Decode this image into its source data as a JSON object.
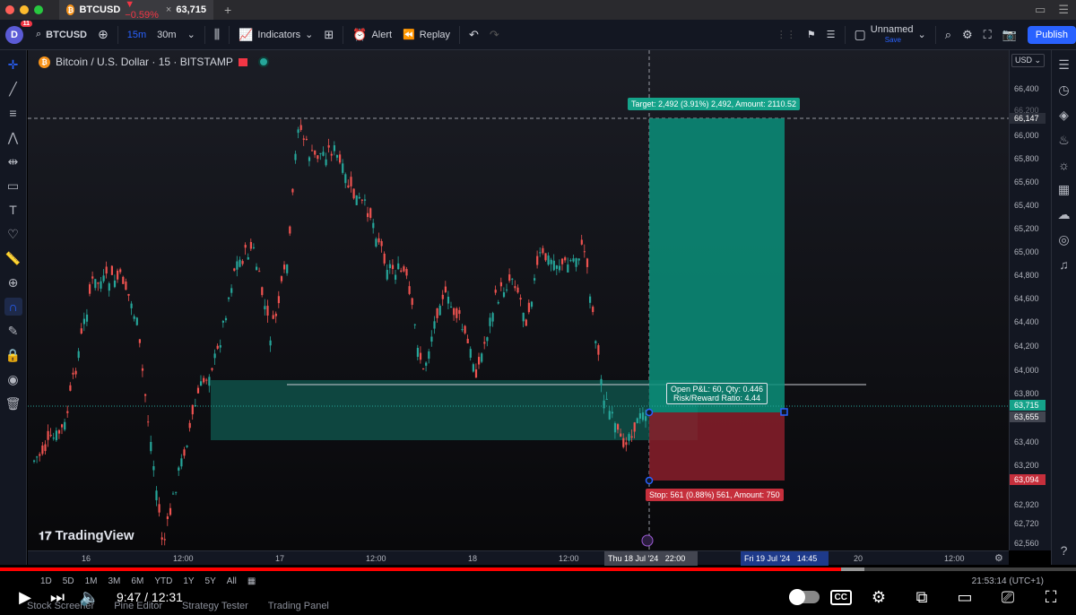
{
  "browser": {
    "tab_symbol": "BTCUSD",
    "tab_price": "63,715",
    "tab_change": "▼ −0.59%",
    "tab_coin": "₿",
    "tab_close": "×",
    "new_tab": "+"
  },
  "toolbar": {
    "avatar": "D",
    "notification_count": "11",
    "symbol": "BTCUSD",
    "interval_active": "15m",
    "interval_fav": "30m",
    "indicators_label": "Indicators",
    "alert_label": "Alert",
    "replay_label": "Replay",
    "layout_name": "Unnamed",
    "layout_status": "Save",
    "publish_label": "Publish"
  },
  "chart": {
    "title": "Bitcoin / U.S. Dollar · 15 · BITSTAMP",
    "logo": "TradingView",
    "target_label": "Target: 2,492 (3.91%) 2,492, Amount: 2110.52",
    "stop_label": "Stop: 561 (0.88%) 561, Amount: 750",
    "pnl_label_1": "Open P&L: 60, Qty: 0.446",
    "pnl_label_2": "Risk/Reward Ratio: 4.44"
  },
  "price_axis": {
    "currency": "USD",
    "ticks": [
      "66,400",
      "66,200",
      "66,000",
      "65,800",
      "65,600",
      "65,400",
      "65,200",
      "65,000",
      "64,800",
      "64,600",
      "64,400",
      "64,200",
      "64,000",
      "63,800",
      "63,400",
      "63,200",
      "62,920",
      "62,720",
      "62,560"
    ],
    "badge_target": "66,147",
    "badge_last": "63,715",
    "badge_entry": "63,655",
    "badge_stop": "63,094"
  },
  "time_axis": {
    "ticks": [
      "16",
      "12:00",
      "17",
      "12:00",
      "18",
      "12:00",
      "20",
      "12:00"
    ],
    "cursor_date": "Thu 18 Jul '24",
    "cursor_time": "22:00",
    "end_date": "Fri 19 Jul '24",
    "end_time": "14:45"
  },
  "bottom": {
    "ranges": [
      "1D",
      "5D",
      "1M",
      "3M",
      "6M",
      "YTD",
      "1Y",
      "5Y",
      "All"
    ],
    "clock": "21:53:14 (UTC+1)",
    "panel_tabs": [
      "Stock Screener",
      "Pine Editor",
      "Strategy Tester",
      "Trading Panel"
    ]
  },
  "video": {
    "current_time": "9:47",
    "duration": "12:31",
    "time_separator": "/",
    "played_fraction": 0.782,
    "buffered_fraction": 0.803,
    "cc_label": "CC"
  },
  "colors": {
    "bull": "#26a69a",
    "bear": "#ef5350",
    "target_zone": "#0b8f7a",
    "stop_zone": "#8a1e2a",
    "brand_blue": "#2962ff"
  }
}
